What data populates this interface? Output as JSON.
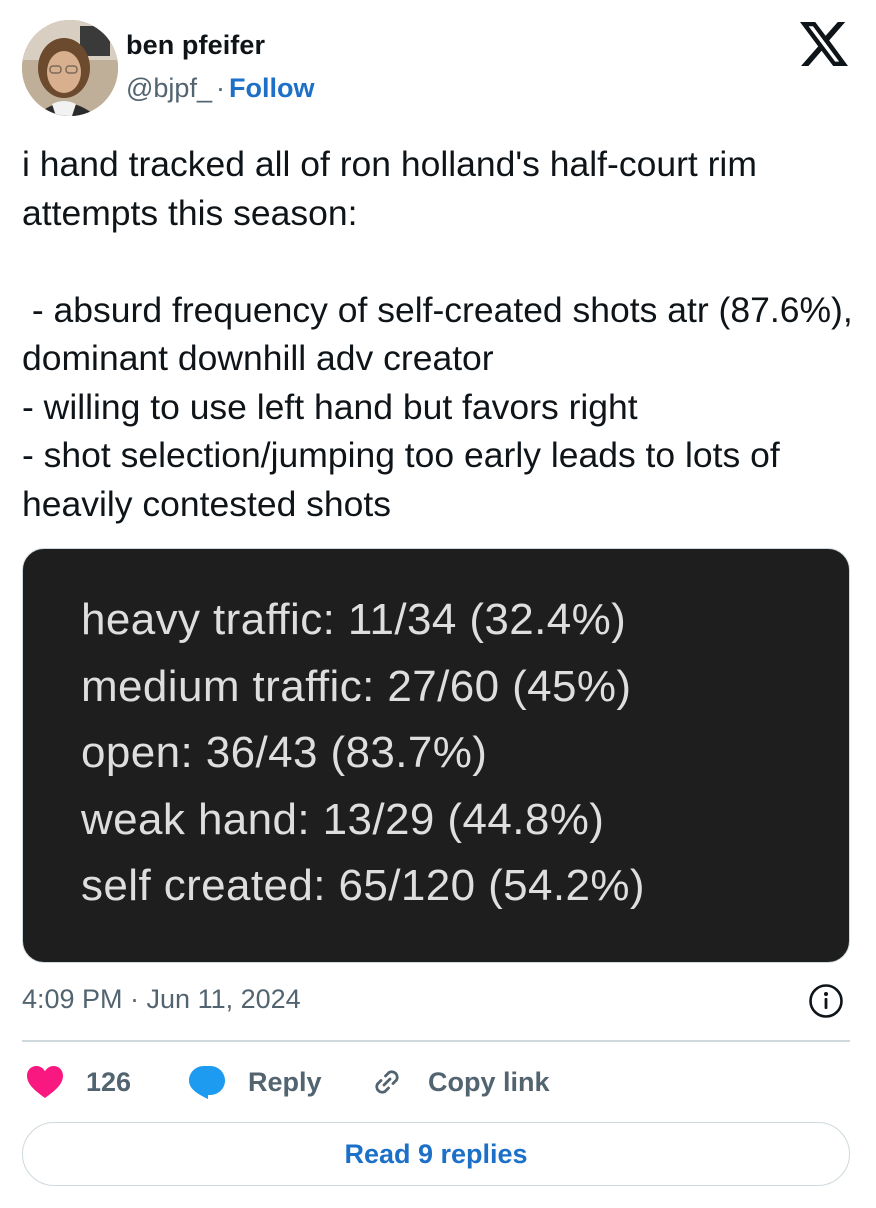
{
  "author": {
    "name": "ben pfeifer",
    "handle": "@bjpf_",
    "separator": "·",
    "follow_label": "Follow"
  },
  "icons": {
    "brand": "x-logo-icon",
    "info": "info-icon",
    "like": "heart-icon",
    "reply": "speech-bubble-icon",
    "copy": "link-icon"
  },
  "colors": {
    "accent": "#1d70c8",
    "like": "#f91880",
    "reply": "#1d9bf0",
    "muted": "#536471",
    "media_bg": "#1e1e1e"
  },
  "tweet": {
    "text": "i hand tracked all of ron holland's half-court rim attempts this season:\n\n - absurd frequency of self-created shots atr (87.6%), dominant downhill adv creator\n- willing to use left hand but favors right\n- shot selection/jumping too early leads to lots of heavily contested shots",
    "media_lines": [
      "heavy traffic: 11/34 (32.4%)",
      "medium traffic: 27/60 (45%)",
      "open: 36/43 (83.7%)",
      "weak hand: 13/29 (44.8%)",
      "self created: 65/120 (54.2%)"
    ],
    "timestamp": "4:09 PM · Jun 11, 2024"
  },
  "actions": {
    "like_count": "126",
    "reply_label": "Reply",
    "copy_label": "Copy link",
    "read_replies_label": "Read 9 replies"
  }
}
